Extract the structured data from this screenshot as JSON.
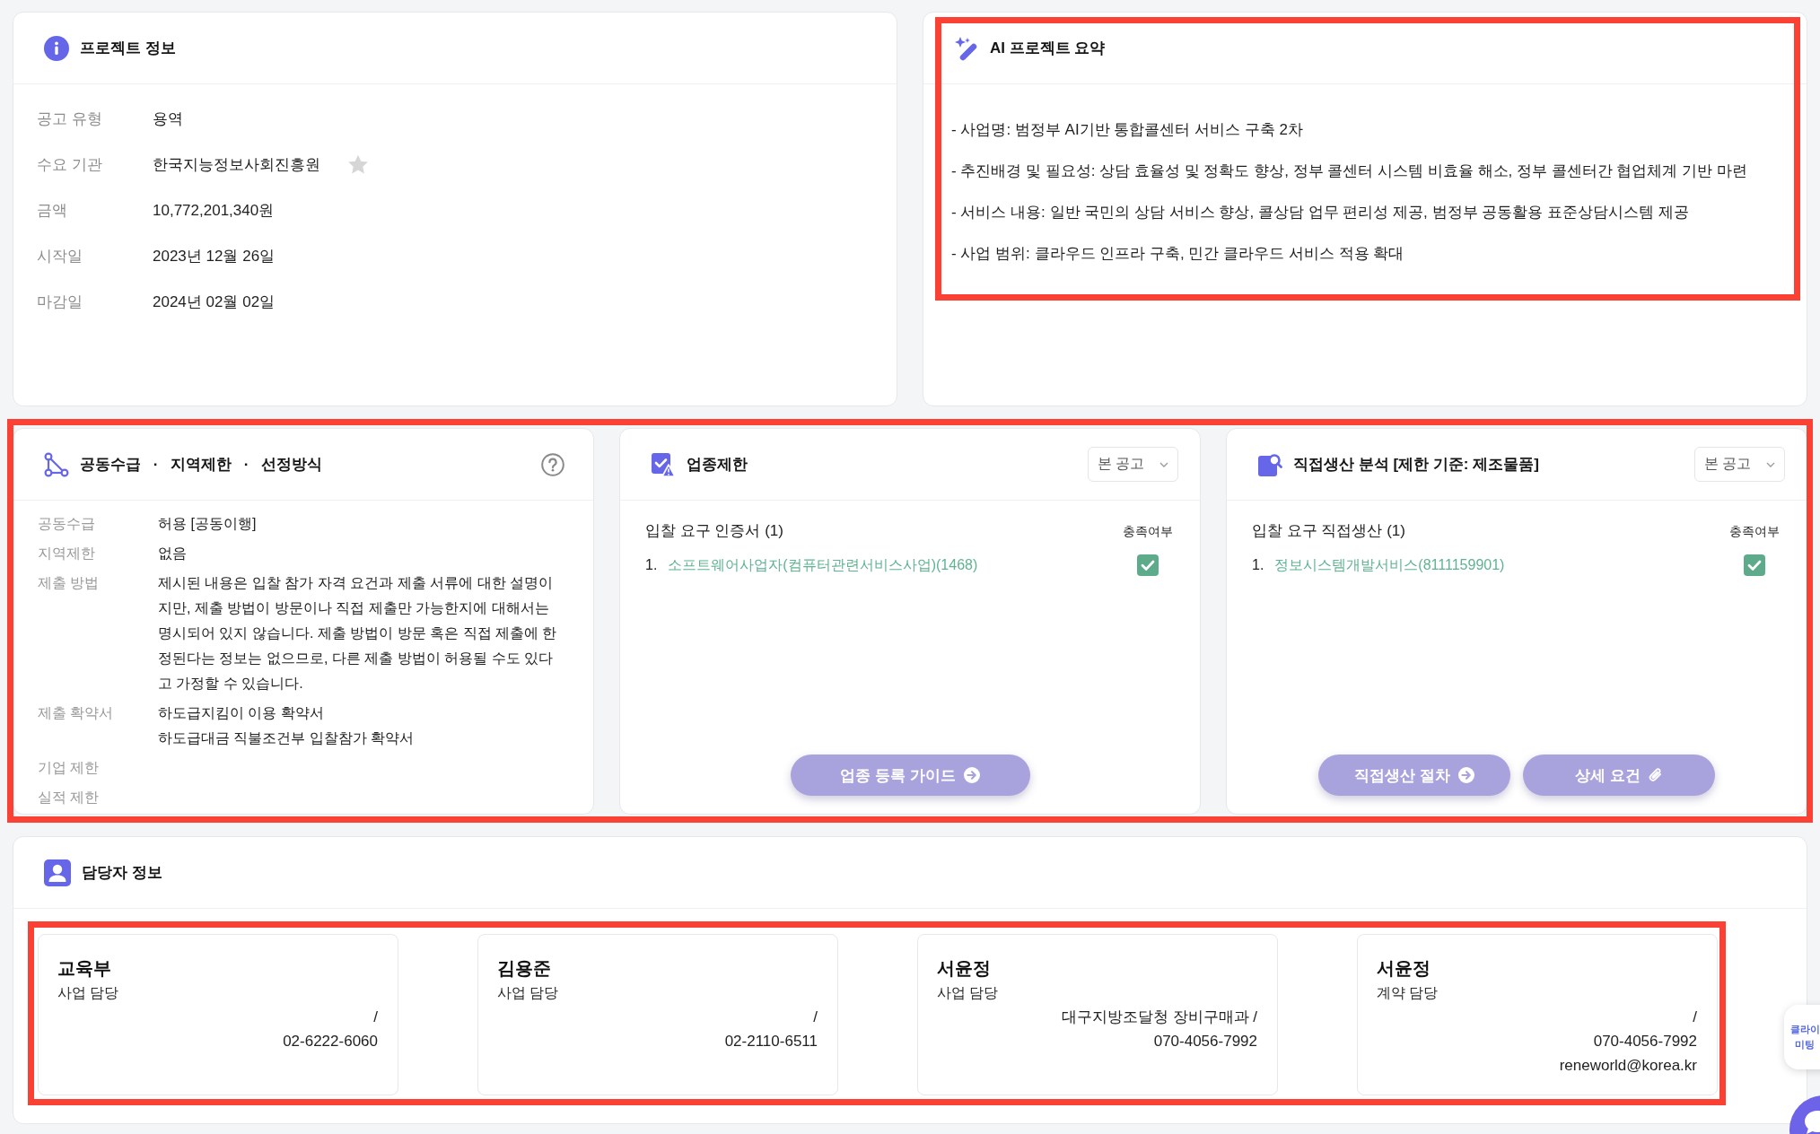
{
  "project_info": {
    "title": "프로젝트 정보",
    "fields": [
      {
        "kind": "text",
        "label": "공고 유형",
        "value": "용역"
      },
      {
        "kind": "starrable",
        "label": "수요 기관",
        "value": "한국지능정보사회진흥원",
        "starred": false
      },
      {
        "kind": "text",
        "label": "금액",
        "value": "10,772,201,340원"
      },
      {
        "kind": "text",
        "label": "시작일",
        "value": "2023년 12월 26일"
      },
      {
        "kind": "text",
        "label": "마감일",
        "value": "2024년 02월 02일"
      }
    ]
  },
  "ai_summary": {
    "title": "AI 프로젝트 요약",
    "highlighted": true,
    "lines": [
      "- 사업명: 범정부 AI기반 통합콜센터 서비스 구축 2차",
      "- 추진배경 및 필요성: 상담 효율성 및 정확도 향상, 정부 콜센터 시스템 비효율 해소, 정부 콜센터간 협업체계 기반 마련",
      "- 서비스 내용: 일반 국민의 상담 서비스 향상, 콜상담 업무 편리성 제공, 범정부 공동활용 표준상담시스템 제공",
      "- 사업 범위: 클라우드 인프라 구축, 민간 클라우드 서비스 적용 확대"
    ]
  },
  "conditions": {
    "highlighted": true,
    "joint_supply": {
      "title": "공동수급 · 지역제한 · 선정방식",
      "rows": [
        {
          "label": "공동수급",
          "values": [
            "허용 [공동이행]"
          ]
        },
        {
          "label": "지역제한",
          "values": [
            "없음"
          ]
        },
        {
          "label": "제출 방법",
          "values": [
            "제시된 내용은 입찰 참가 자격 요건과 제출 서류에 대한 설명이지만, 제출 방법이 방문이나 직접 제출만 가능한지에 대해서는 명시되어 있지 않습니다. 제출 방법이 방문 혹은 직접 제출에 한정된다는 정보는 없으므로, 다른 제출 방법이 허용될 수도 있다고 가정할 수 있습니다."
          ]
        },
        {
          "label": "제출 확약서",
          "values": [
            "하도급지킴이 이용 확약서",
            "하도급대금 직불조건부 입찰참가 확약서"
          ]
        },
        {
          "label": "기업 제한"
        },
        {
          "label": "실적 제한"
        }
      ]
    },
    "industry": {
      "title": "업종제한",
      "select_value": "본 공고",
      "list_title": "입찰 요구 인증서 (1)",
      "status_header": "충족여부",
      "items": [
        {
          "number": "1.",
          "name": "소프트웨어사업자(컴퓨터관련서비스사업)(1468)",
          "checked": true
        }
      ],
      "buttons": [
        {
          "kind": "next",
          "label": "업종 등록 가이드"
        }
      ]
    },
    "direct_production": {
      "title": "직접생산 분석 [제한 기준: 제조물품]",
      "select_value": "본 공고",
      "list_title": "입찰 요구 직접생산 (1)",
      "status_header": "충족여부",
      "items": [
        {
          "number": "1.",
          "name": "정보시스템개발서비스(8111159901)",
          "checked": true
        }
      ],
      "buttons": [
        {
          "kind": "next",
          "label": "직접생산 절차"
        },
        {
          "kind": "attachment",
          "label": "상세 요건"
        }
      ]
    }
  },
  "contacts": {
    "title": "담당자 정보",
    "highlighted": true,
    "people": [
      {
        "name": "교육부",
        "role": "사업 담당",
        "lines": [
          "/",
          "02-6222-6060"
        ]
      },
      {
        "name": "김용준",
        "role": "사업 담당",
        "lines": [
          "/",
          "02-2110-6511"
        ]
      },
      {
        "name": "서윤정",
        "role": "사업 담당",
        "lines": [
          "대구지방조달청 장비구매과 /",
          "070-4056-7992"
        ]
      },
      {
        "name": "서윤정",
        "role": "계약 담당",
        "lines": [
          "/",
          "070-4056-7992",
          "reneworld@korea.kr"
        ]
      }
    ]
  },
  "floating_widget": {
    "lines": [
      "클라이",
      "미팅"
    ]
  }
}
